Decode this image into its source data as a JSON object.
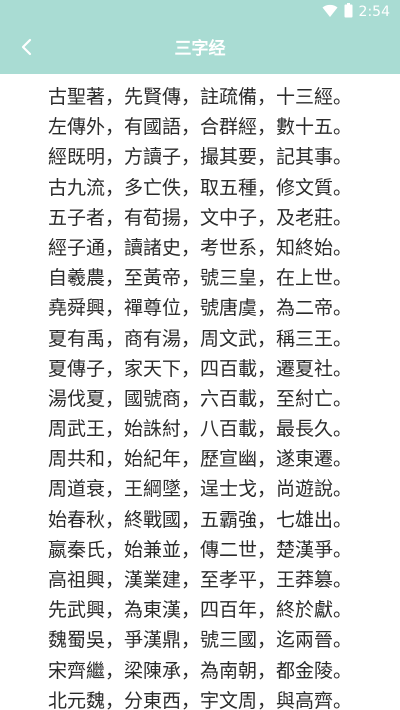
{
  "status_bar": {
    "time": "2:54",
    "icons": [
      "wifi-icon",
      "battery-icon"
    ]
  },
  "app_bar": {
    "title": "三字经",
    "back_icon": "chevron-left-icon"
  },
  "colors": {
    "app_bar_bg": "#a9dcd3",
    "title_text": "#ffffff",
    "body_text": "#2b2b2b",
    "background": "#ffffff"
  },
  "verses": [
    "古聖著，先賢傳，註疏備，十三經。",
    "左傳外，有國語，合群經，數十五。",
    "經既明，方讀子，撮其要，記其事。",
    "古九流，多亡佚，取五種，修文質。",
    "五子者，有荀揚，文中子，及老莊。",
    "經子通，讀諸史，考世系，知終始。",
    "自羲農，至黃帝，號三皇，在上世。",
    "堯舜興，禪尊位，號唐虞，為二帝。",
    "夏有禹，商有湯，周文武，稱三王。",
    "夏傳子，家天下，四百載，遷夏社。",
    "湯伐夏，國號商，六百載，至紂亡。",
    "周武王，始誅紂，八百載，最長久。",
    "周共和，始紀年，歷宣幽，遂東遷。",
    "周道衰，王綱墜，逞士戈，尚遊說。",
    "始春秋，終戰國，五霸強，七雄出。",
    "嬴秦氏，始兼並，傳二世，楚漢爭。",
    "高祖興，漢業建，至孝平，王莽篡。",
    "先武興，為東漢，四百年，終於獻。",
    "魏蜀吳，爭漢鼎，號三國，迄兩晉。",
    "宋齊繼，梁陳承，為南朝，都金陵。",
    "北元魏，分東西，宇文周，與高齊。"
  ]
}
